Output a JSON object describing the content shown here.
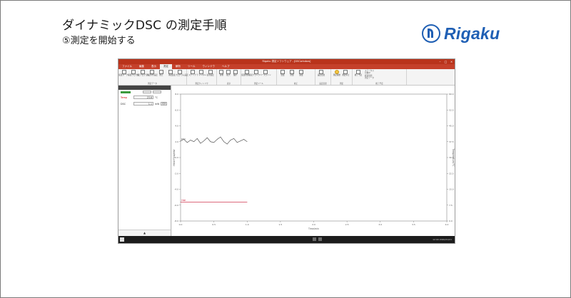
{
  "slide": {
    "title": "ダイナミックDSC の測定手順",
    "subtitle": "⑤測定を開始する",
    "logo_text": "Rigaku",
    "brand_color": "#1f5fb4"
  },
  "app": {
    "window_title": "Rigaku 測定ソフトウェア - [DSCwindow]",
    "accent_color": "#c5402a",
    "menu": [
      "ファイル",
      "編集",
      "表示",
      "測定",
      "解析",
      "ツール",
      "ウィンドウ",
      "ヘルプ"
    ],
    "active_menu_index": 3,
    "ribbon_groups": [
      {
        "name": "測定データ",
        "buttons": [
          "装置オープン",
          "装置クローズ",
          "測定プログラム",
          "測定条件設定",
          "校正",
          "補正",
          "温度プログラム設定"
        ]
      },
      {
        "name": "測定ウィンドウ",
        "buttons": [
          "ステップ",
          "チャンネル",
          "表示設定"
        ]
      },
      {
        "name": "表示",
        "buttons": [
          "自動",
          "拡大",
          "縮小"
        ]
      },
      {
        "name": "測定ツール",
        "buttons": [
          "装置状態確認",
          "ブランク",
          "ベースライン"
        ]
      },
      {
        "name": "校正",
        "buttons": [
          "温度",
          "熱量",
          "感度"
        ]
      },
      {
        "name": "設定変更",
        "buttons": [
          "設定変更"
        ]
      },
      {
        "name": "測定",
        "buttons": [
          "測定開始",
          "測定停止"
        ]
      },
      {
        "name": "終了予定",
        "buttons": [
          "終了予定"
        ],
        "lines": [
          "ステータス",
          "待機中",
          "経過時間",
          "測定データ"
        ]
      }
    ],
    "highlighted_button": "測定開始",
    "left_panel": {
      "temp_label": "Temp",
      "temp_value": "23.6",
      "temp_unit": "°C",
      "dsc_label": "DSC",
      "dsc_value": "1.1",
      "dsc_unit": "mW",
      "dsc_button": "表示",
      "expand_symbol": "▲"
    },
    "taskbar_tray": "12:00  2020/01/01"
  },
  "chart_data": {
    "type": "line",
    "xlabel": "Time/min",
    "ylabel": "Heat Flow/mW",
    "y2label": "Temperature/°C",
    "xlim": [
      0,
      4
    ],
    "x_ticks": [
      "0.0",
      "0.5",
      "1.0",
      "1.5",
      "2.0",
      "2.5",
      "3.0",
      "3.5",
      "4.0"
    ],
    "ylim": [
      -8,
      8
    ],
    "y_ticks": [
      "8.0",
      "6.0",
      "4.0",
      "2.0",
      "0.0",
      "-2.0",
      "-4.0",
      "-6.0",
      "-8.0"
    ],
    "y2lim": [
      0,
      60
    ],
    "y2_ticks": [
      "60.0",
      "52.5",
      "45.0",
      "37.5",
      "30.0",
      "22.5",
      "15.0",
      "7.5",
      "0.0"
    ],
    "grid": false,
    "series": [
      {
        "name": "DSC",
        "color": "#555555",
        "x": [
          0.0,
          0.05,
          0.1,
          0.15,
          0.2,
          0.25,
          0.3,
          0.35,
          0.4,
          0.45,
          0.5,
          0.55,
          0.6,
          0.65,
          0.7,
          0.75,
          0.8,
          0.85,
          0.9,
          0.95,
          1.0
        ],
        "y": [
          2.1,
          2.3,
          1.9,
          2.2,
          2.0,
          2.4,
          1.8,
          2.1,
          2.5,
          2.0,
          1.9,
          2.3,
          2.6,
          2.0,
          1.7,
          2.2,
          2.4,
          1.9,
          2.1,
          2.3,
          2.0
        ]
      },
      {
        "name": "TMP",
        "color": "#c8102e",
        "x": [
          0.0,
          0.25,
          0.5,
          0.75,
          1.0
        ],
        "y": [
          -5.6,
          -5.6,
          -5.6,
          -5.6,
          -5.6
        ]
      }
    ]
  }
}
